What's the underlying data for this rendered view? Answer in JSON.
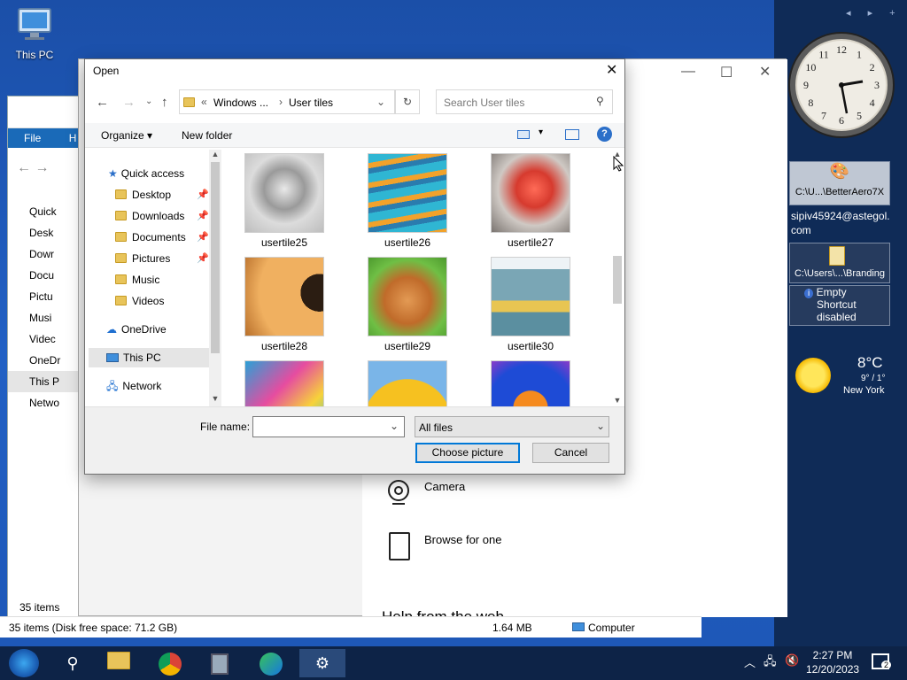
{
  "desktop": {
    "this_pc_label": "This PC"
  },
  "gadgets": {
    "nav": "◂ ▸ +",
    "clock_numbers": [
      "12",
      "1",
      "2",
      "3",
      "4",
      "5",
      "6",
      "7",
      "8",
      "9",
      "10",
      "11"
    ],
    "launcher1": "C:\\U...\\BetterAero7X",
    "email": "sipiv45924@astegol.com",
    "launcher2": "C:\\Users\\...\\Branding",
    "info1": "Empty",
    "info2": "Shortcut disabled",
    "weather_temp": "8°C",
    "weather_range": "9° / 1°",
    "weather_city": "New York"
  },
  "explorer": {
    "ribbon_file": "File",
    "ribbon_home": "H",
    "nav_items": [
      "Quick",
      "Desk",
      "Dowr",
      "Docu",
      "Pictu",
      "Musi",
      "Videc",
      "OneDr",
      "This P",
      "Netwo"
    ],
    "items_count": "35 items",
    "status_left": "35 items (Disk free space: 71.2 GB)",
    "status_size": "1.64 MB",
    "status_computer": "Computer"
  },
  "settings": {
    "camera": "Camera",
    "browse": "Browse for one",
    "partial_heading": "Help from the web"
  },
  "dialog": {
    "title": "Open",
    "breadcrumb_parent": "Windows ...",
    "breadcrumb_current": "User tiles",
    "search_placeholder": "Search User tiles",
    "organize": "Organize",
    "new_folder": "New folder",
    "nav": {
      "quick_access": "Quick access",
      "desktop": "Desktop",
      "downloads": "Downloads",
      "documents": "Documents",
      "pictures": "Pictures",
      "music": "Music",
      "videos": "Videos",
      "onedrive": "OneDrive",
      "this_pc": "This PC",
      "network": "Network"
    },
    "files": [
      "usertile25",
      "usertile26",
      "usertile27",
      "usertile28",
      "usertile29",
      "usertile30"
    ],
    "file_name_label": "File name:",
    "file_name_value": "",
    "file_type": "All files",
    "choose_button": "Choose picture",
    "cancel_button": "Cancel"
  },
  "taskbar": {
    "time": "2:27 PM",
    "date": "12/20/2023",
    "notification_count": "2"
  }
}
